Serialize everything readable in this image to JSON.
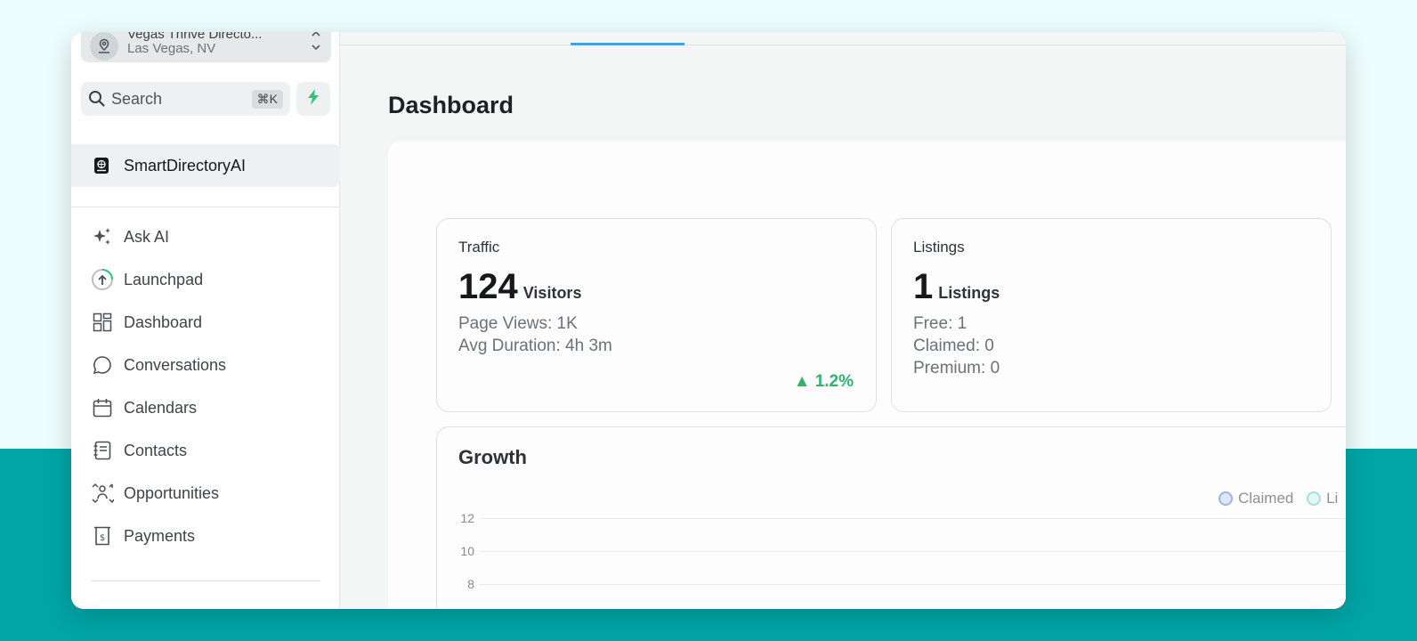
{
  "sidebar": {
    "location": {
      "name": "Vegas Thrive Directo...",
      "city": "Las Vegas, NV"
    },
    "search": {
      "label": "Search",
      "shortcut": "⌘K"
    },
    "brand": {
      "label": "SmartDirectoryAI"
    },
    "nav": [
      {
        "label": "Ask AI",
        "icon": "sparkles-icon"
      },
      {
        "label": "Launchpad",
        "icon": "launchpad-icon"
      },
      {
        "label": "Dashboard",
        "icon": "dashboard-grid-icon"
      },
      {
        "label": "Conversations",
        "icon": "chat-bubble-icon"
      },
      {
        "label": "Calendars",
        "icon": "calendar-icon"
      },
      {
        "label": "Contacts",
        "icon": "contacts-book-icon"
      },
      {
        "label": "Opportunities",
        "icon": "opportunities-icon"
      },
      {
        "label": "Payments",
        "icon": "payments-icon"
      }
    ]
  },
  "main": {
    "title": "Dashboard",
    "traffic": {
      "title": "Traffic",
      "value": "124",
      "unit": "Visitors",
      "page_views": "Page Views: 1K",
      "avg_duration": "Avg Duration: 4h 3m",
      "trend": "▲ 1.2%"
    },
    "listings": {
      "title": "Listings",
      "value": "1",
      "unit": "Listings",
      "free": "Free: 1",
      "claimed": "Claimed: 0",
      "premium": "Premium: 0"
    },
    "growth": {
      "title": "Growth",
      "legend": [
        {
          "label": "Claimed",
          "color": "#c9d3f5"
        },
        {
          "label": "Li",
          "color": "#c8ecee"
        }
      ],
      "y_ticks": [
        "12",
        "10",
        "8"
      ]
    }
  },
  "colors": {
    "accent_tab": "#4a9fd8",
    "trend_up": "#2fb36b",
    "quick_action": "#2fc47a"
  }
}
